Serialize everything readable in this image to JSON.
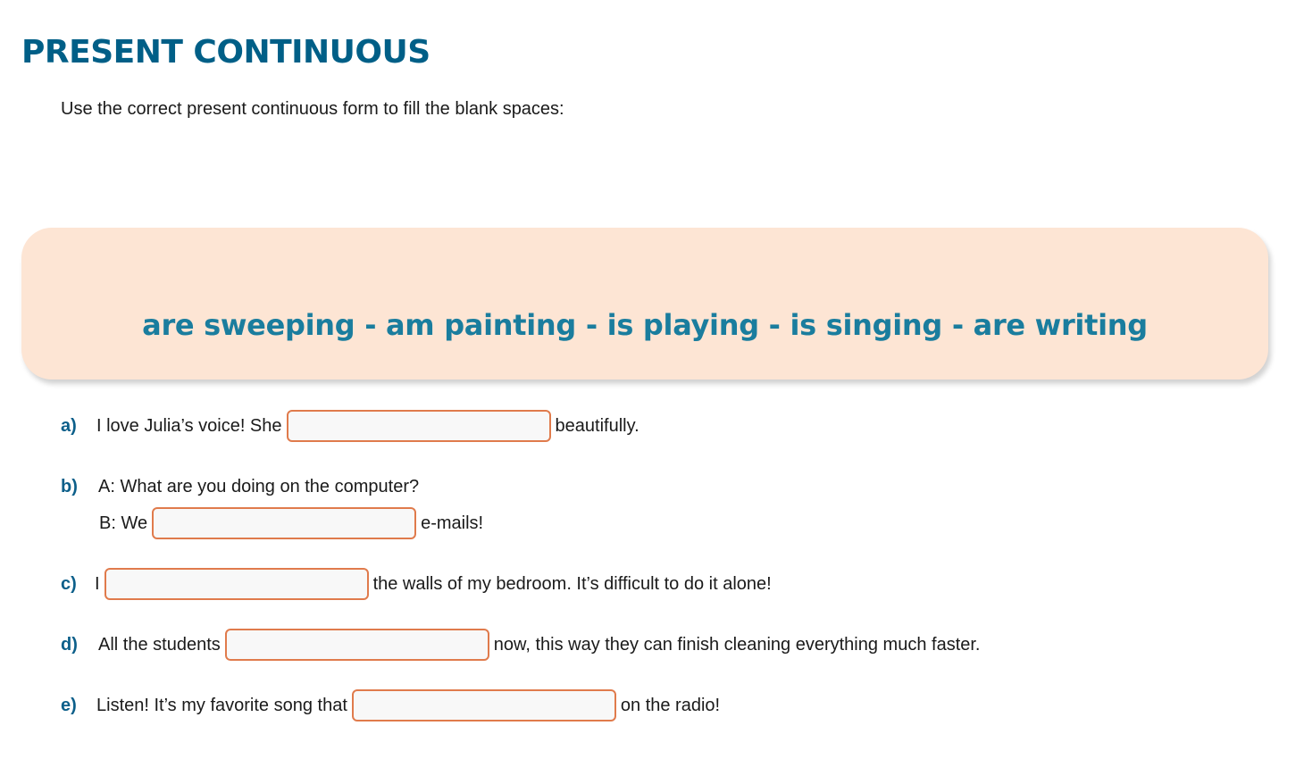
{
  "title": "PRESENT CONTINUOUS",
  "instruction": "Use the correct present continuous form to fill the blank spaces:",
  "word_bank": "are sweeping - am painting - is playing - is singing - are writing",
  "exercises": {
    "a": {
      "letter": "a)",
      "before": "I love Julia’s voice! She",
      "after": "beautifully.",
      "value": ""
    },
    "b": {
      "letter": "b)",
      "question": "A: What are you doing on the computer?",
      "before": "B: We",
      "after": "e-mails!",
      "value": ""
    },
    "c": {
      "letter": "c)",
      "before": "I",
      "after": "the walls of my bedroom. It’s difficult to do it alone!",
      "value": ""
    },
    "d": {
      "letter": "d)",
      "before": "All the students",
      "after": "now, this way they can finish cleaning everything much faster.",
      "value": ""
    },
    "e": {
      "letter": "e)",
      "before": "Listen! It’s my favorite song that",
      "after": "on the radio!",
      "value": ""
    }
  },
  "colors": {
    "title": "#005f87",
    "word_bank_text": "#1a7d9e",
    "word_bank_background": "#fde5d4",
    "blank_border": "#e07b4c"
  }
}
